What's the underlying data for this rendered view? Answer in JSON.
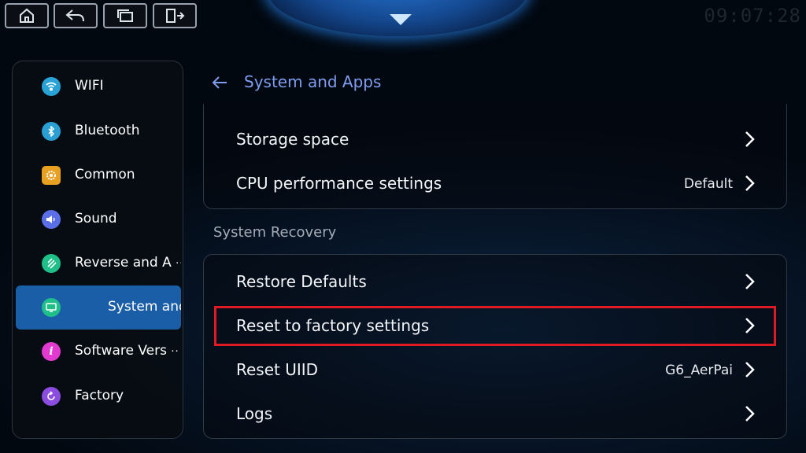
{
  "topbar": {
    "buttons": [
      {
        "name": "home-icon"
      },
      {
        "name": "back-icon"
      },
      {
        "name": "windows-icon"
      },
      {
        "name": "exit-icon"
      }
    ],
    "clock": "09:07:28"
  },
  "sidebar": {
    "items": [
      {
        "label": "WIFI",
        "icon": "wifi-icon",
        "color": "#29a3d6"
      },
      {
        "label": "Bluetooth",
        "icon": "bluetooth-icon",
        "color": "#2a9fd4"
      },
      {
        "label": "Common",
        "icon": "gear-icon",
        "color": "#e8a020"
      },
      {
        "label": "Sound",
        "icon": "speaker-icon",
        "color": "#5a6ee8"
      },
      {
        "label": "Reverse and A",
        "icon": "reverse-icon",
        "color": "#1fbf8a"
      },
      {
        "label": "System and",
        "icon": "system-icon",
        "color": "#1fbf8a"
      },
      {
        "label": "Software Vers",
        "icon": "info-icon",
        "color": "#e23ad0"
      },
      {
        "label": "Factory",
        "icon": "factory-icon",
        "color": "#8a4de0"
      }
    ]
  },
  "header": {
    "title": "System and Apps"
  },
  "storage_panel": {
    "rows": [
      {
        "label": "Storage space",
        "value": ""
      },
      {
        "label": "CPU performance settings",
        "value": "Default"
      }
    ]
  },
  "recovery": {
    "section_title": "System Recovery",
    "rows": [
      {
        "label": "Restore Defaults",
        "value": ""
      },
      {
        "label": "Reset to factory settings",
        "value": ""
      },
      {
        "label": "Reset UIID",
        "value": "G6_AerPai"
      },
      {
        "label": "Logs",
        "value": ""
      }
    ]
  },
  "colors": {
    "accent": "#7f9cf0",
    "active": "#1b5ea8",
    "highlight": "#e01a22"
  }
}
